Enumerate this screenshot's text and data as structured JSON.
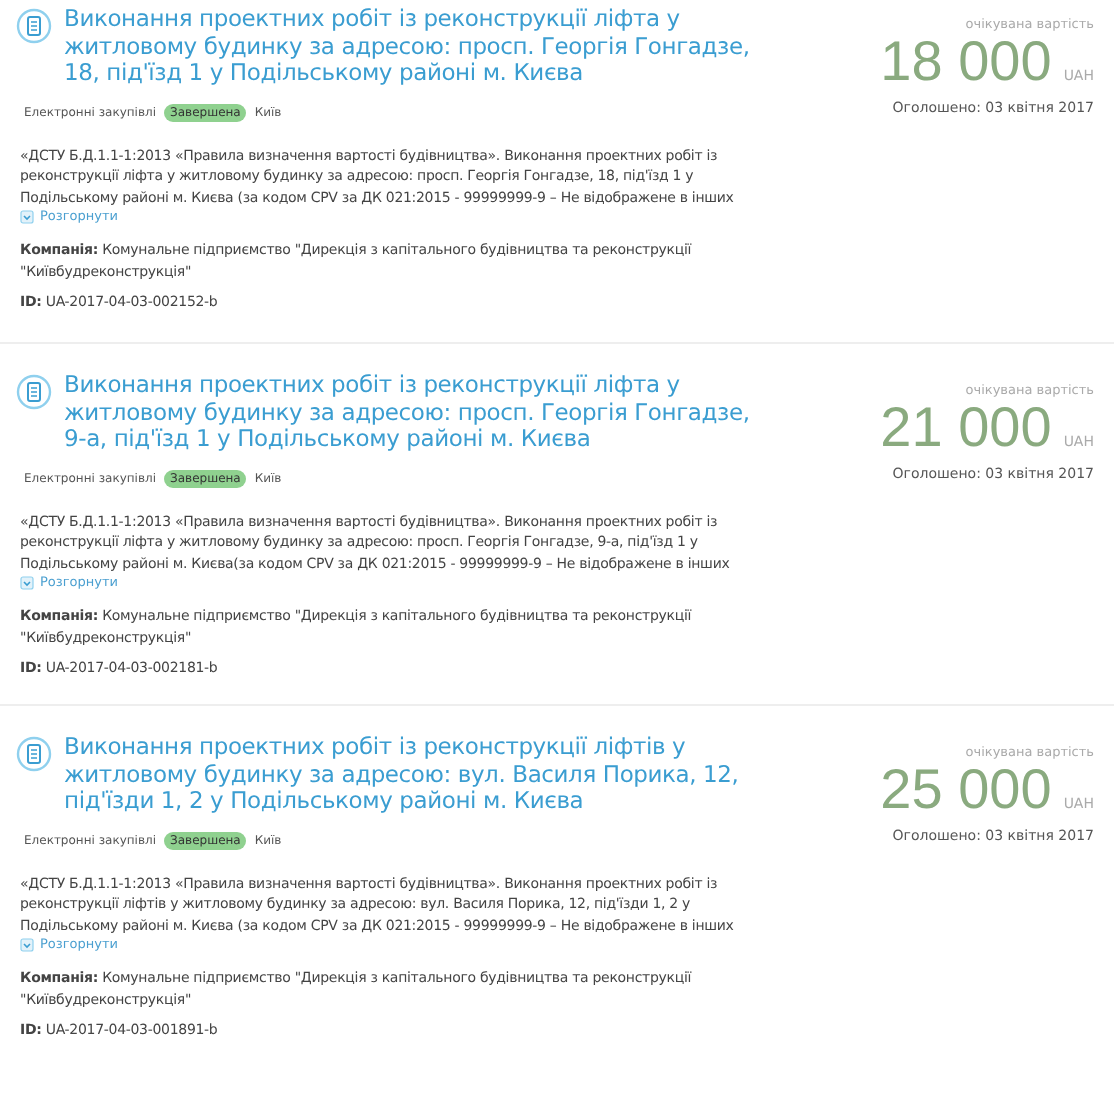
{
  "tenders": [
    {
      "title": "Виконання проектних робіт із реконструкції ліфта у житловому будинку за адресою: просп. Георгія Гонгадзе, 18, під'їзд 1 у Подільському районі м. Києва",
      "tags": [
        {
          "kind": "plain",
          "label": "Електронні закупівлі"
        },
        {
          "kind": "status",
          "label": "Завершена"
        },
        {
          "kind": "plain",
          "label": "Київ"
        }
      ],
      "description": "«ДСТУ Б.Д.1.1-1:2013 «Правила визначення вартості будівництва». Виконання проектних робіт із реконструкції ліфта у житловому будинку за адресою: просп. Георгія Гонгадзе, 18, під'їзд 1 у Подільському районі м. Києва (за кодом CPV за ДК 021:2015 - 99999999-9 – Не відображене в інших",
      "expand": "Розгорнути",
      "company": "**Компанія:** Комунальне підприємство \"Дирекція з капітального будівництва та реконструкції \"Київбудреконструкція\"",
      "id": "**ID:** UA-2017-04-03-002152-b",
      "value_label": "очікувана вартість",
      "amount": "18 000",
      "currency": "UAH",
      "announced": "Оголошено: 03 квітня 2017"
    },
    {
      "title": "Виконання проектних робіт із реконструкції ліфта у житловому будинку за адресою: просп. Георгія Гонгадзе, 9-а, під'їзд 1 у Подільському районі м. Києва",
      "tags": [
        {
          "kind": "plain",
          "label": "Електронні закупівлі"
        },
        {
          "kind": "status",
          "label": "Завершена"
        },
        {
          "kind": "plain",
          "label": "Київ"
        }
      ],
      "description": "«ДСТУ Б.Д.1.1-1:2013 «Правила визначення вартості будівництва». Виконання проектних робіт із реконструкції ліфта у житловому будинку за адресою: просп. Георгія Гонгадзе, 9-а, під'їзд 1 у Подільському районі м. Києва(за кодом CPV за ДК 021:2015 - 99999999-9 – Не відображене в інших",
      "expand": "Розгорнути",
      "company": "**Компанія:** Комунальне підприємство \"Дирекція з капітального будівництва та реконструкції \"Київбудреконструкція\"",
      "id": "**ID:** UA-2017-04-03-002181-b",
      "value_label": "очікувана вартість",
      "amount": "21 000",
      "currency": "UAH",
      "announced": "Оголошено: 03 квітня 2017"
    },
    {
      "title": "Виконання проектних робіт із реконструкції ліфтів у житловому будинку за адресою: вул. Василя Порика, 12, під'їзди 1, 2 у Подільському районі м. Києва",
      "tags": [
        {
          "kind": "plain",
          "label": "Електронні закупівлі"
        },
        {
          "kind": "status",
          "label": "Завершена"
        },
        {
          "kind": "plain",
          "label": "Київ"
        }
      ],
      "description": "«ДСТУ Б.Д.1.1-1:2013 «Правила визначення вартості будівництва». Виконання проектних робіт із реконструкції ліфтів у житловому будинку за адресою: вул. Василя Порика, 12, під'їзди 1, 2 у Подільському районі м. Києва (за кодом CPV за ДК 021:2015 - 99999999-9 – Не відображене в інших",
      "expand": "Розгорнути",
      "company": "**Компанія:** Комунальне підприємство \"Дирекція з капітального будівництва та реконструкції \"Київбудреконструкція\"",
      "id": "**ID:** UA-2017-04-03-001891-b",
      "value_label": "очікувана вартість",
      "amount": "25 000",
      "currency": "UAH",
      "announced": "Оголошено: 03 квітня 2017"
    }
  ]
}
